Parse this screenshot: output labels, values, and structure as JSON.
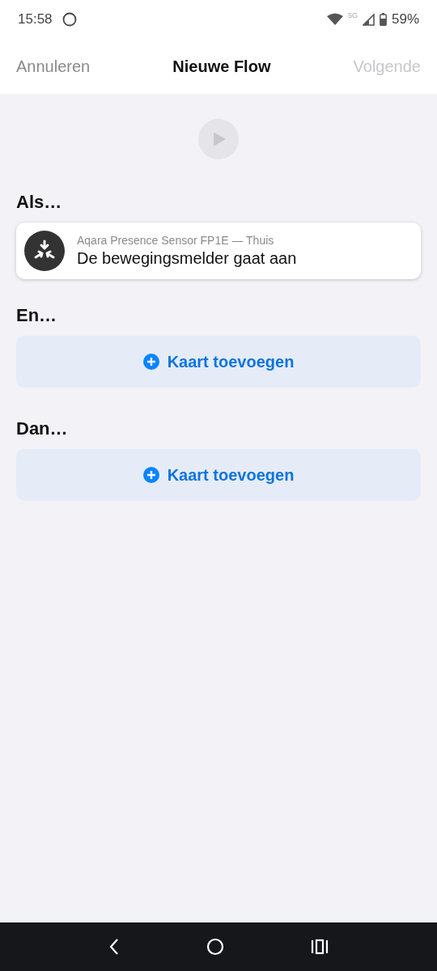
{
  "status_bar": {
    "time": "15:58",
    "network": "5G",
    "battery": "59%"
  },
  "header": {
    "cancel": "Annuleren",
    "title": "Nieuwe Flow",
    "next": {
      "label": "Volgende",
      "disabled": true
    }
  },
  "play_button": {
    "disabled": true
  },
  "sections": [
    {
      "heading": "Als…",
      "cards": [
        {
          "kind": "device",
          "device": "Aqara Presence Sensor FP1E — Thuis",
          "text": "De bewegingsmelder gaat aan"
        }
      ]
    },
    {
      "heading": "En…",
      "cards": [
        {
          "kind": "add",
          "text": "Kaart toevoegen"
        }
      ]
    },
    {
      "heading": "Dan…",
      "cards": [
        {
          "kind": "add",
          "text": "Kaart toevoegen"
        }
      ]
    }
  ]
}
